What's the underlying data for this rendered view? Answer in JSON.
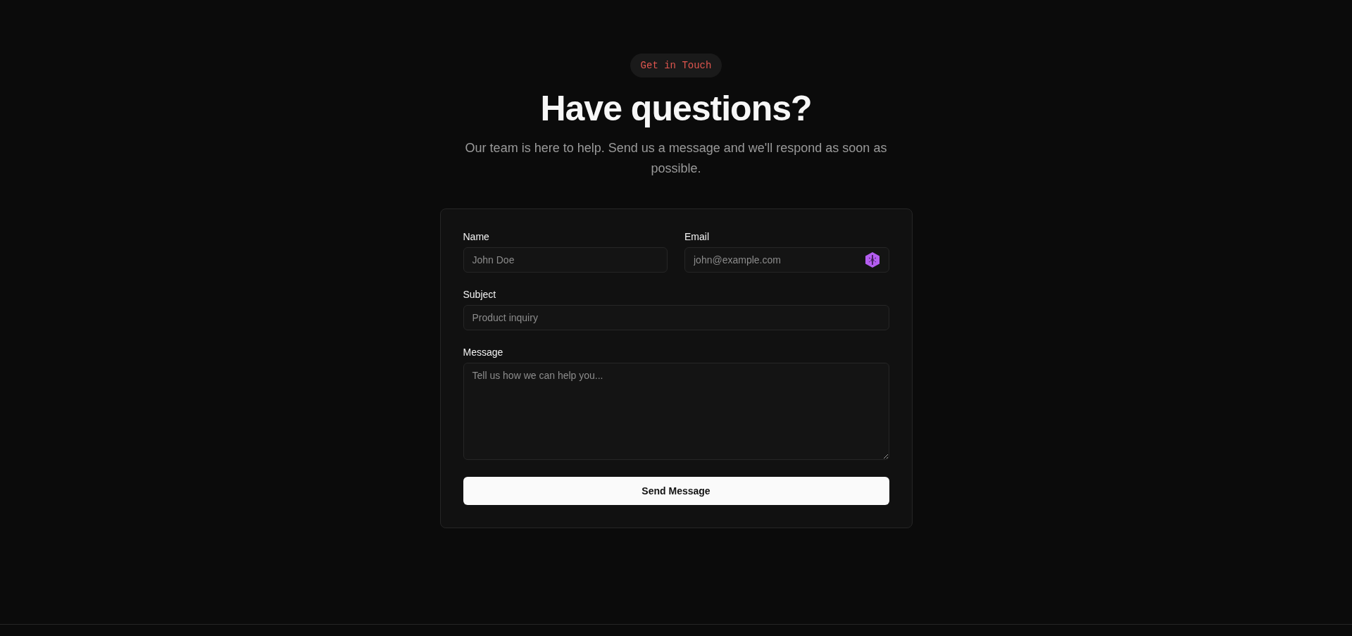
{
  "badge": "Get in Touch",
  "heading": "Have questions?",
  "subtitle": "Our team is here to help. Send us a message and we'll respond as soon as possible.",
  "form": {
    "fields": [
      {
        "kind": "input",
        "label": "Name",
        "placeholder": "John Doe"
      },
      {
        "kind": "input",
        "label": "Email",
        "placeholder": "john@example.com"
      },
      {
        "kind": "input",
        "label": "Subject",
        "placeholder": "Product inquiry"
      },
      {
        "kind": "textarea",
        "label": "Message",
        "placeholder": "Tell us how we can help you..."
      }
    ],
    "submit": "Send Message"
  }
}
